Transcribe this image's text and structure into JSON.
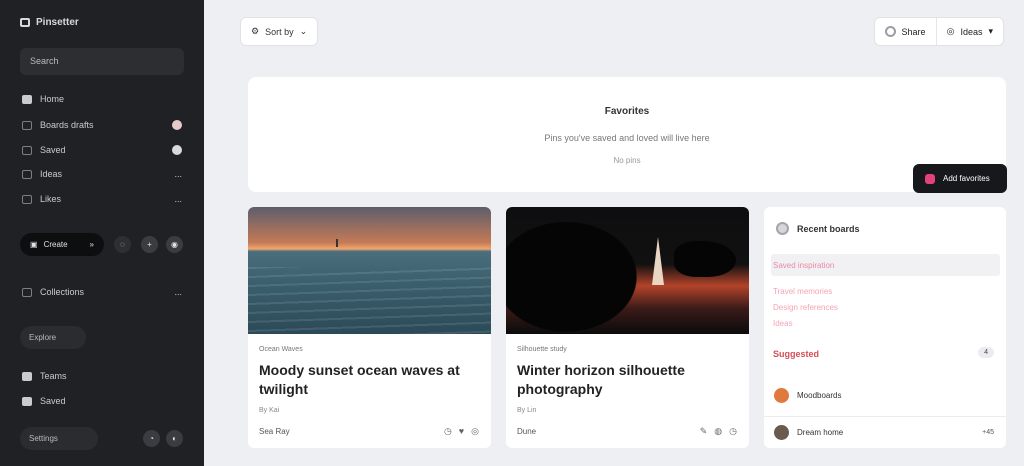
{
  "sidebar": {
    "app_title": "Pinsetter",
    "search_placeholder": "Search",
    "items": [
      {
        "label": "Home",
        "icon": "home-icon"
      },
      {
        "label": "Boards drafts",
        "icon": "board-icon",
        "right": ""
      },
      {
        "label": "Saved",
        "icon": "bookmark-icon",
        "right": ""
      },
      {
        "label": "Ideas",
        "icon": "bulb-icon",
        "right": "..."
      },
      {
        "label": "Likes",
        "icon": "heart-icon",
        "right": "..."
      }
    ],
    "create_label": "Create",
    "create_menu": "»",
    "tool_icons": [
      "+",
      "◉"
    ],
    "collections_label": "Collections",
    "collections_right": "...",
    "ghost_button": "Explore",
    "bottom_items": [
      {
        "label": "Teams",
        "icon": "team-icon"
      },
      {
        "label": "Saved",
        "icon": "save-icon"
      }
    ],
    "footer_button": "Settings",
    "footer_icons": [
      "◔",
      "◐"
    ]
  },
  "toolbar": {
    "filter_label": "Sort by",
    "share_label": "Share",
    "user_label": "Ideas"
  },
  "hero": {
    "title": "Favorites",
    "subtitle": "Pins you've saved and loved will live here",
    "hint": "No pins"
  },
  "float_button": "Add favorites",
  "cards": [
    {
      "meta": "Ocean Waves",
      "title": "Moody sunset ocean waves at twilight",
      "sub": "By Kai",
      "author": "Sea Ray",
      "actions": [
        "◷",
        "♥",
        "◎"
      ]
    },
    {
      "meta": "Silhouette study",
      "title": "Winter horizon silhouette photography",
      "sub": "By Lin",
      "author": "Dune",
      "actions": [
        "✎",
        "◍",
        "◷"
      ]
    }
  ],
  "panel": {
    "header": "Recent boards",
    "pink_items": [
      "Saved inspiration",
      "Travel memories",
      "Design references",
      "Ideas"
    ],
    "section_label": "Suggested",
    "section_count": "4",
    "rows": [
      {
        "label": "Moodboards",
        "right": ""
      },
      {
        "label": "Dream home",
        "right": "+45"
      }
    ]
  },
  "colors": {
    "sidebar_bg": "#1f2124",
    "page_bg": "#eeeff3",
    "accent_pink": "#e2417b",
    "accent_red": "#d34d55",
    "dark_button": "#17181b"
  }
}
